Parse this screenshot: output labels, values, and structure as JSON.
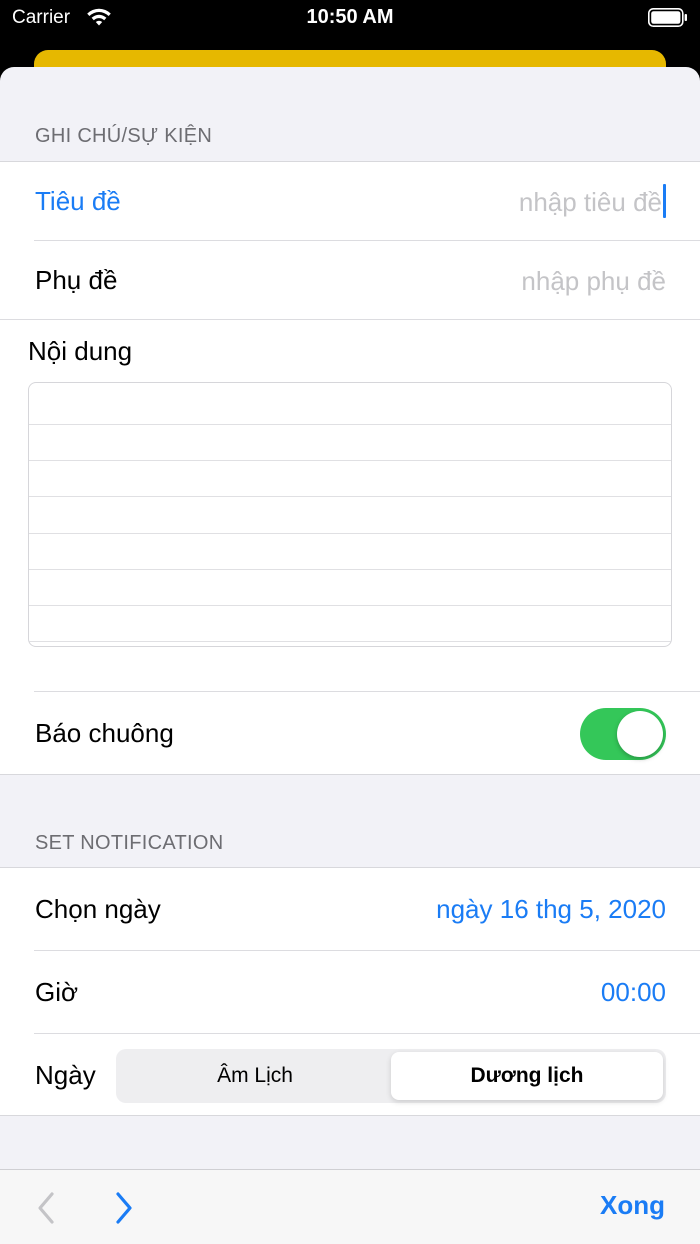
{
  "status_bar": {
    "carrier": "Carrier",
    "time": "10:50 AM"
  },
  "note_section": {
    "header": "GHI CHÚ/SỰ KIỆN",
    "title_label": "Tiêu đề",
    "title_placeholder": "nhập tiêu đề",
    "subtitle_label": "Phụ đề",
    "subtitle_placeholder": "nhập phụ đề",
    "content_label": "Nội dung",
    "content_value": "",
    "alarm_label": "Báo chuông",
    "alarm_on": true
  },
  "notification_section": {
    "header": "SET NOTIFICATION",
    "date_label": "Chọn ngày",
    "date_value": "ngày 16 thg 5, 2020",
    "time_label": "Giờ",
    "time_value": "00:00",
    "calendar_label": "Ngày",
    "calendar_options": [
      "Âm Lịch",
      "Dương lịch"
    ],
    "calendar_selected": "Dương lịch"
  },
  "toolbar": {
    "done_label": "Xong"
  },
  "colors": {
    "accent": "#1a7cf5",
    "toggle_on": "#34c759",
    "header_card": "#e6b800"
  },
  "icons": {
    "wifi": "wifi-icon",
    "battery": "battery-icon",
    "prev": "chevron-left-icon",
    "next": "chevron-right-icon"
  }
}
